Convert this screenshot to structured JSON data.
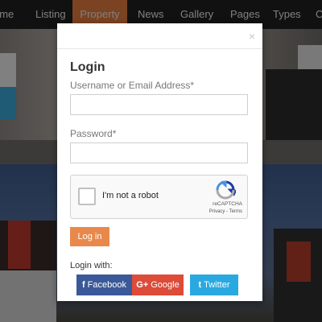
{
  "nav": {
    "items": [
      "ome",
      "Listing",
      "Property",
      "News",
      "Gallery",
      "Pages",
      "Types",
      "C"
    ],
    "active_index": 2,
    "accent_color": "#e07b3c"
  },
  "modal": {
    "close_glyph": "×",
    "title": "Login",
    "username_label": "Username or Email Address*",
    "username_value": "",
    "password_label": "Password*",
    "password_value": "",
    "recaptcha": {
      "label": "I'm not a robot",
      "brand": "reCAPTCHA",
      "links": "Privacy - Terms",
      "icon": "recaptcha-icon"
    },
    "login_button": "Log in",
    "login_button_color": "#e8894b",
    "login_with_label": "Login with:",
    "social": [
      {
        "label": "Facebook",
        "icon": "f",
        "color": "#3b5998"
      },
      {
        "label": "Google",
        "icon": "G+",
        "color": "#dd4b39"
      },
      {
        "label": "Twitter",
        "icon": "t",
        "color": "#2aa9e0"
      }
    ]
  }
}
